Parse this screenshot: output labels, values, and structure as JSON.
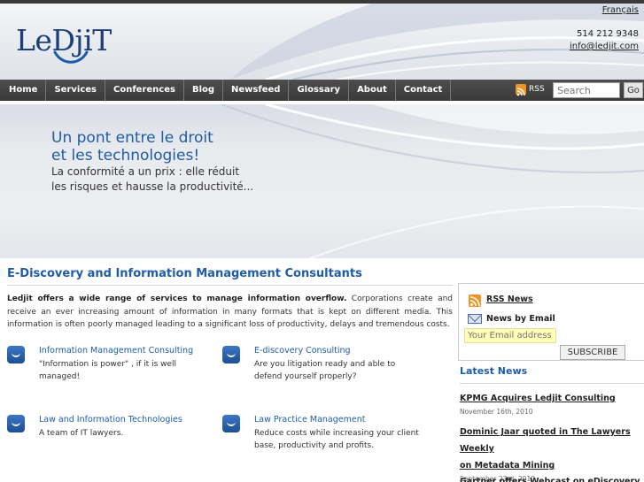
{
  "header": {
    "logo_text": "LeDjiT",
    "language_link": "Français",
    "phone": "514 212 9348",
    "email": "info@ledjit.com"
  },
  "nav": {
    "items": [
      "Home",
      "Services",
      "Conferences",
      "Blog",
      "Newsfeed",
      "Glossary",
      "About",
      "Contact"
    ],
    "rss_label": "RSS",
    "search_placeholder": "Search",
    "search_button": "Go"
  },
  "banner": {
    "headline_line1": "Un pont entre le droit",
    "headline_line2": "et les technologies!",
    "sub_line1": "La conformité a un prix : elle réduit",
    "sub_line2": "les risques et hausse la productivité..."
  },
  "main": {
    "title": "E-Discovery and Information Management Consultants",
    "intro_bold": "Ledjit offers a wide range of services to manage information overflow.",
    "intro_rest": " Corporations create and receive an ever increasing amount of information in many formats that is kept on different media. This information is often poorly managed leading to a significant loss of productivity, delays and tremendous costs.",
    "services": [
      {
        "title": "Information Management Consulting",
        "desc": "\"Information is power\" , if it is well managed!"
      },
      {
        "title": "E-discovery Consulting",
        "desc": "Are you litigation ready and able to defend yourself properly?"
      },
      {
        "title": "Law and Information Technologies",
        "desc": "A team of IT lawyers."
      },
      {
        "title": "Law Practice Management",
        "desc": "Reduce costs while increasing your client base, productivity and profits."
      }
    ]
  },
  "sidebar": {
    "rss_news": "RSS News",
    "news_by_email": "News by Email",
    "email_placeholder": "Your Email address",
    "subscribe_button": "SUBSCRIBE",
    "latest_title": "Latest News",
    "news": [
      {
        "title": "KPMG Acquires Ledjit Consulting",
        "date": "November 16th, 2010"
      },
      {
        "title_line1": "Dominic Jaar quoted in The Lawyers Weekly",
        "title_line2": "on Metadata Mining",
        "date": "September 23rd, 2010"
      },
      {
        "title": "Gartner offers Webcast on eDiscovery"
      }
    ]
  },
  "colors": {
    "accent_blue": "#1f5ca8",
    "nav_bg": "#3a3a3a",
    "rss_orange": "#f29423",
    "email_field_bg": "#ffffb8"
  },
  "icons": [
    "rss-icon",
    "mail-icon",
    "service-smile-icon",
    "logo-smile-icon"
  ]
}
